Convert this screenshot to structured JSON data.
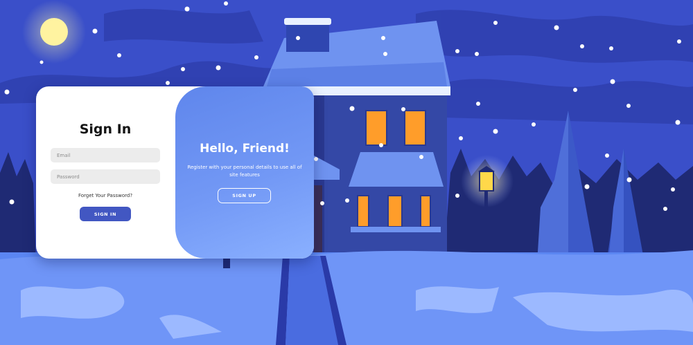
{
  "signin": {
    "title": "Sign In",
    "email_placeholder": "Email",
    "password_placeholder": "Password",
    "forgot_link": "Forget Your Password?",
    "button_label": "SIGN IN"
  },
  "toggle": {
    "title": "Hello, Friend!",
    "text": "Register with your personal details to use all of site features",
    "button_label": "SIGN UP"
  },
  "colors": {
    "sky": "#3a4fc9",
    "snow": "#5b86f2",
    "primary_button": "#4257c2",
    "panel_gradient_start": "#5f86ec",
    "panel_gradient_end": "#8ab0ff"
  }
}
